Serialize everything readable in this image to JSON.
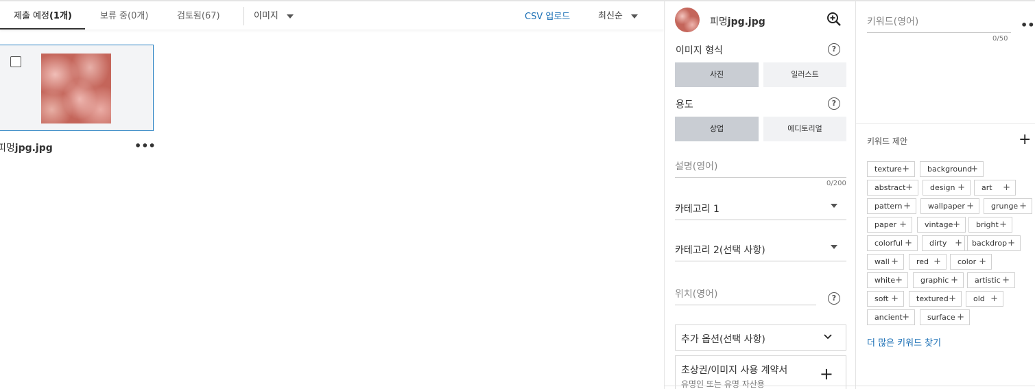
{
  "tabs": [
    {
      "label": "제출 예정",
      "count": "(1개)"
    },
    {
      "label": "보류 중(0개)"
    },
    {
      "label": "검토됨(67)"
    }
  ],
  "filter": {
    "type_label": "이미지",
    "sort_label": "최신순"
  },
  "csv_upload_label": "CSV 업로드",
  "card": {
    "filename_prefix": "피멍",
    "filename_ext": "jpg.jpg",
    "more_label": "•••"
  },
  "meta": {
    "filename_prefix": "피멍",
    "filename_ext": "jpg.jpg",
    "image_type_label": "이미지 형식",
    "image_type_options": [
      "사진",
      "일러스트"
    ],
    "image_type_selected": "사진",
    "usage_label": "용도",
    "usage_options": [
      "상업",
      "에디토리얼"
    ],
    "usage_selected": "상업",
    "description_placeholder": "설명(영어)",
    "description_counter": "0/200",
    "category1": "카테고리 1",
    "category2": "카테고리 2(선택 사항)",
    "location_placeholder": "위치(영어)",
    "extra_options": "추가 옵션(선택 사항)",
    "release_title": "초상권/이미지 사용 계약서",
    "release_sub": "유명인 또는 유명 자산용"
  },
  "keywords": {
    "input_placeholder": "키워드(영어)",
    "counter": "0/50",
    "more_label": "•••",
    "suggest_title": "키워드 제안",
    "more_link": "더 많은 키워드 찾기",
    "suggestions": [
      [
        "texture",
        "background"
      ],
      [
        "abstract",
        "design",
        "art"
      ],
      [
        "pattern",
        "wallpaper",
        "grunge"
      ],
      [
        "paper",
        "vintage",
        "bright"
      ],
      [
        "colorful",
        "dirty",
        "backdrop"
      ],
      [
        "wall",
        "red",
        "color"
      ],
      [
        "white",
        "graphic",
        "artistic"
      ],
      [
        "soft",
        "textured",
        "old"
      ],
      [
        "ancient",
        "surface"
      ]
    ]
  },
  "colors": {
    "accent": "#1a6fb5",
    "selected_border": "#2680c2",
    "segment_on": "#c9cdd3"
  }
}
